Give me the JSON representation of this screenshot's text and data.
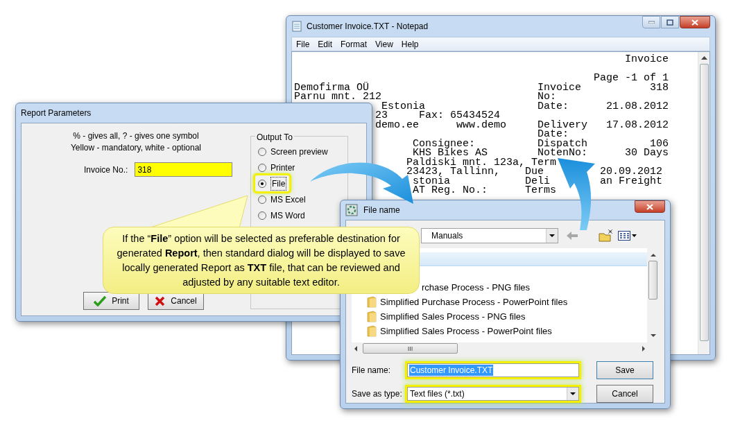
{
  "notepad": {
    "title": "Customer Invoice.TXT - Notepad",
    "menu": [
      "File",
      "Edit",
      "Format",
      "View",
      "Help"
    ],
    "lines": [
      [
        "Invoice"
      ],
      [
        "Page -1 of 1"
      ],
      [
        "Demofirma OÜ",
        "Invoice",
        "318"
      ],
      [
        "Parnu mnt. 212",
        "No:"
      ],
      [
        "Estonia",
        "Date:",
        "21.08.2012"
      ],
      [
        "23",
        "Fax: 65434524"
      ],
      [
        "demo.ee",
        "www.demo",
        "Delivery",
        "17.08.2012"
      ],
      [
        "Date:"
      ],
      [
        "Consignee:",
        "Dispatch",
        "106"
      ],
      [
        "KHS Bikes AS",
        "NotenNo:",
        "30 Days"
      ],
      [
        "Paldiski mnt. 123a, Term"
      ],
      [
        "23423, Tallinn,",
        "Due",
        "20.09.2012"
      ],
      [
        "stonia",
        "Deli",
        "an Freight"
      ],
      [
        "AT Reg. No.:",
        "Terms"
      ]
    ]
  },
  "report": {
    "title": "Report Parameters",
    "hints": [
      "% - gives all, ? - gives one symbol",
      "Yellow - mandatory, white - optional"
    ],
    "field": {
      "label": "Invoice No.:",
      "value": "318",
      "mandatory": true
    },
    "output": {
      "title": "Output To",
      "options": [
        {
          "label": "Screen preview",
          "selected": false,
          "highlighted": false
        },
        {
          "label": "Printer",
          "selected": false,
          "highlighted": false
        },
        {
          "label": "File",
          "selected": true,
          "highlighted": true
        },
        {
          "label": "MS Excel",
          "selected": false,
          "highlighted": false
        },
        {
          "label": "MS Word",
          "selected": false,
          "highlighted": false
        }
      ]
    },
    "buttons": [
      {
        "kind": "ok",
        "label": "Print"
      },
      {
        "kind": "cancel",
        "label": "Cancel"
      }
    ]
  },
  "callout": {
    "text": "If the “**File**” option will be selected as preferable destination for generated **Report**, then standard dialog will be displayed to save locally generated Report as **TXT** file, that can be reviewed and adjusted by any suitable text editor."
  },
  "file_dialog": {
    "title": "File name",
    "folder": "Manuals",
    "items": [
      "rchase Process - PNG files",
      "Simplified Purchase Process - PowerPoint files",
      "Simplified Sales Process - PNG files",
      "Simplified Sales Process - PowerPoint files"
    ],
    "file_name": {
      "label": "File name:",
      "value": "Customer Invoice.TXT",
      "highlighted": true
    },
    "file_type": {
      "label": "Save as type:",
      "value": "Text files (*.txt)",
      "highlighted": true
    },
    "buttons": [
      "Save",
      "Cancel"
    ]
  }
}
